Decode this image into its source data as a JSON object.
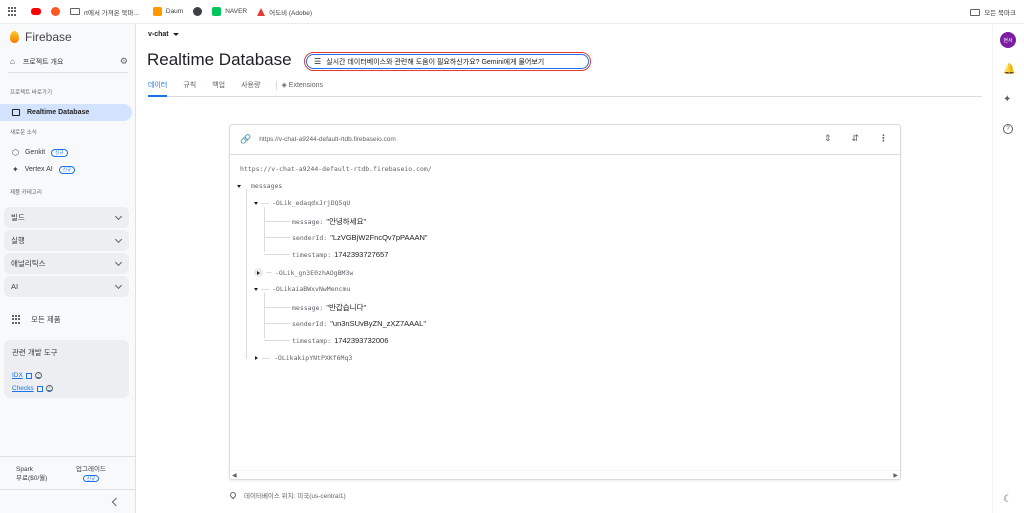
{
  "bookmarks_bar": {
    "items": [
      {
        "label": "",
        "icon": "apps-grid-icon"
      },
      {
        "label": "",
        "icon": "youtube-icon",
        "color": "#ff0000"
      },
      {
        "label": "",
        "icon": "flame-icon",
        "color": "#ff5722"
      },
      {
        "label": "rt에서 가져온 북마...",
        "icon": "folder-icon"
      },
      {
        "label": "Daum",
        "icon": "daum-icon",
        "color": "#ff9800"
      },
      {
        "label": "",
        "icon": "chrome-icon"
      },
      {
        "label": "NAVER",
        "icon": "naver-icon",
        "color": "#03c75a"
      },
      {
        "label": "어도비 (Adobe)",
        "icon": "adobe-icon",
        "color": "#e53935"
      }
    ],
    "all_bookmarks": "모든 북마크"
  },
  "sidebar": {
    "brand": "Firebase",
    "overview": "프로젝트 개요",
    "shortcuts_title": "프로젝트 바로가기",
    "active_item": "Realtime Database",
    "news_title": "새로운 소식",
    "news_items": [
      {
        "label": "Genkit",
        "badge": "신규"
      },
      {
        "label": "Vertex AI",
        "badge": "신규"
      }
    ],
    "categories_title": "제품 카테고리",
    "categories": [
      "빌드",
      "실행",
      "애널리틱스",
      "AI"
    ],
    "all_products": "모든 제품",
    "tools": {
      "title": "관련 개발 도구",
      "links": [
        "IDX",
        "Checks"
      ]
    },
    "plan": {
      "name": "Spark",
      "detail": "무료($0/월)"
    },
    "upgrade": {
      "label": "업그레이드",
      "badge": "신규"
    }
  },
  "header": {
    "project": "v-chat",
    "title": "Realtime Database",
    "gemini_prompt": "실시간 데이터베이스와 관련해 도움이 필요하신가요? Gemini에게 물어보기"
  },
  "tabs": [
    {
      "label": "데이터",
      "active": true
    },
    {
      "label": "규칙",
      "active": false
    },
    {
      "label": "백업",
      "active": false
    },
    {
      "label": "사용량",
      "active": false
    },
    {
      "label": "Extensions",
      "active": false
    }
  ],
  "database": {
    "url": "https://v-chat-a9244-default-rtdb.firebaseio.com",
    "root_url": "https://v-chat-a9244-default-rtdb.firebaseio.com/",
    "root_key": "messages",
    "nodes": [
      {
        "key": "-OLik_edaqdxJrjDQ5qU",
        "expanded": true,
        "fields": [
          {
            "k": "message:",
            "v": "\"안녕하세요\""
          },
          {
            "k": "senderId:",
            "v": "\"LzVGBjW2FncQv7pPAAAN\""
          },
          {
            "k": "timestamp:",
            "v": "1742393727657"
          }
        ]
      },
      {
        "key": "-OLik_gn3E0zhAOgBM3w",
        "expanded": false,
        "fields": []
      },
      {
        "key": "-OLikaiaBWxvNwMencmu",
        "expanded": true,
        "fields": [
          {
            "k": "message:",
            "v": "\"반갑습니다\""
          },
          {
            "k": "senderId:",
            "v": "\"un3nSUvByZN_zXZ7AAAL\""
          },
          {
            "k": "timestamp:",
            "v": "1742393732006"
          }
        ]
      },
      {
        "key": "-OLikakipYNtPXKf6Mq3",
        "expanded": false,
        "fields": []
      }
    ],
    "location": "데이터베이스 위치: 미국(us-central1)"
  },
  "right_rail": {
    "avatar": "현서",
    "icons": [
      "notifications-icon",
      "gemini-spark-icon",
      "help-icon",
      "dark-mode-icon"
    ]
  },
  "colors": {
    "accent": "#1a73e8",
    "active_nav_bg": "#d3e3fd",
    "gemini_border": "#e53935",
    "avatar_bg": "#7b1fa2"
  }
}
